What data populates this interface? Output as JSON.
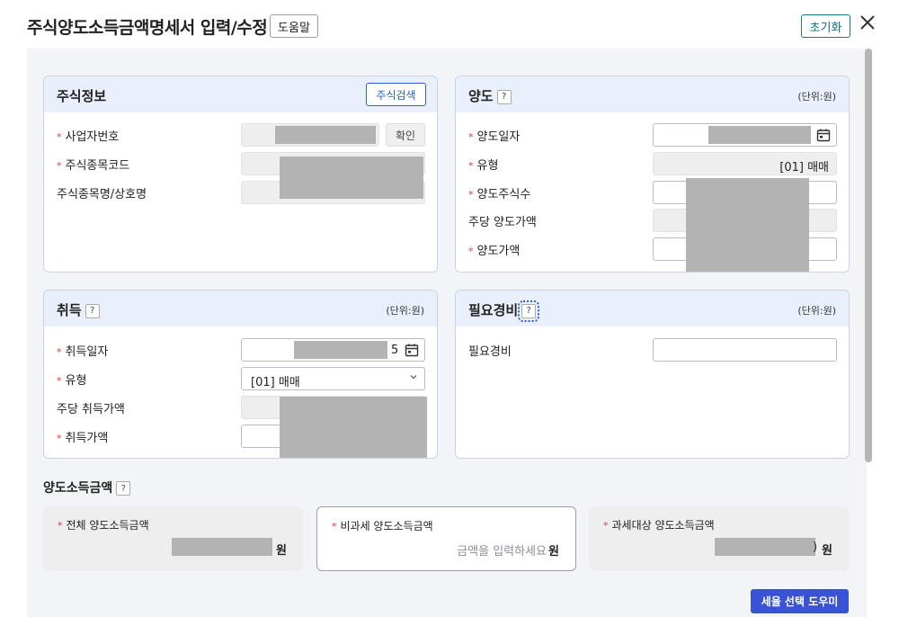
{
  "header": {
    "title": "주식양도소득금액명세서 입력/수정",
    "help_label": "도움말",
    "reset_label": "초기화"
  },
  "stock_info": {
    "title": "주식정보",
    "search_label": "주식검색",
    "business_no_label": "사업자번호",
    "confirm_label": "확인",
    "stock_code_label": "주식종목코드",
    "stock_name_label": "주식종목명/상호명"
  },
  "transfer": {
    "title": "양도",
    "unit": "(단위:원)",
    "date_label": "양도일자",
    "type_label": "유형",
    "type_value": "[01] 매매",
    "qty_label": "양도주식수",
    "per_share_label": "주당 양도가액",
    "price_label": "양도가액"
  },
  "acquire": {
    "title": "취득",
    "unit": "(단위:원)",
    "date_label": "취득일자",
    "date_fragment": "5",
    "type_label": "유형",
    "type_value": "[01] 매매",
    "per_share_label": "주당 취득가액",
    "price_label": "취득가액"
  },
  "expense": {
    "title": "필요경비",
    "unit": "(단위:원)",
    "field_label": "필요경비"
  },
  "income": {
    "title": "양도소득금액",
    "total_label": "전체 양도소득금액",
    "nontax_label": "비과세 양도소득금액",
    "nontax_placeholder": "금액을 입력하세요",
    "taxable_label": "과세대상 양도소득금액",
    "currency": "원",
    "taxable_fragment": ")"
  },
  "footer": {
    "tax_helper_label": "세율 선택 도우미"
  },
  "colors": {
    "accent": "#2b62c8",
    "required": "#e03a3a",
    "teal": "#126b7a",
    "header_bg": "#e9f0fb",
    "primary_button": "#3a53d6"
  }
}
